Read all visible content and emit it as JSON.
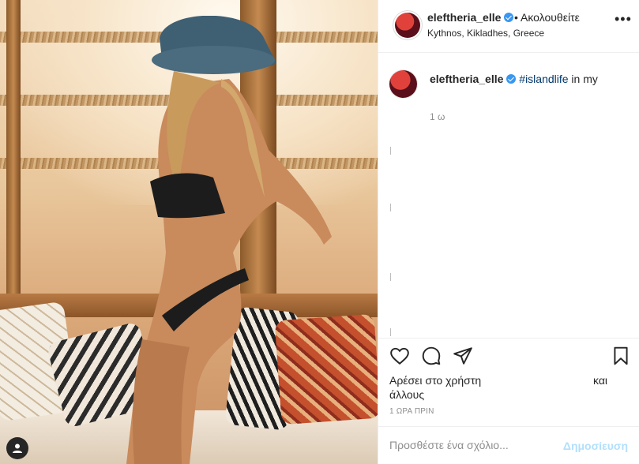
{
  "header": {
    "username": "eleftheria_elle",
    "follow_label": "• Ακολουθείτε",
    "location": "Kythnos, Kikladhes, Greece",
    "more_icon": "more-horizontal-icon"
  },
  "caption": {
    "username": "eleftheria_elle",
    "hashtag": "#islandlife",
    "text": " in my",
    "time": "1 ω"
  },
  "actions": {
    "icons": [
      "heart-icon",
      "comment-icon",
      "share-icon",
      "bookmark-icon"
    ]
  },
  "likes": {
    "line1": "Αρέσει στο χρήστη",
    "connector": "και",
    "line2": "άλλους"
  },
  "timestamp": "1 ΩΡΑ ΠΡΙΝ",
  "comment": {
    "placeholder": "Προσθέστε ένα σχόλιο...",
    "publish_label": "Δημοσίευση"
  },
  "colors": {
    "link": "#00376b",
    "verified": "#3897f0",
    "publish_disabled": "#b2dffc",
    "muted": "#8e8e8e"
  }
}
